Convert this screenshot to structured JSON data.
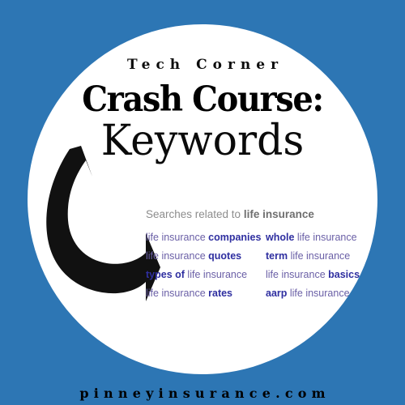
{
  "colors": {
    "background_blue": "#2d76b4",
    "circle_white": "#ffffff",
    "title_black": "#000000",
    "heading_gray": "#8d8d8d",
    "keyword_purple": "#6a5fa6",
    "keyword_bold_blue": "#2f2fa0",
    "arrow_black": "#111111"
  },
  "header": {
    "kicker": "Tech Corner",
    "title": "Crash Course:",
    "subtitle": "Keywords"
  },
  "arrow": {
    "icon": "curved-arrow-icon",
    "direction": "down-right"
  },
  "search": {
    "heading_prefix": "Searches related to ",
    "heading_term": "life insurance",
    "columns": 2,
    "items": [
      {
        "prefix": "life insurance ",
        "bold": "companies",
        "suffix": ""
      },
      {
        "prefix": "",
        "bold": "whole",
        "suffix": " life insurance"
      },
      {
        "prefix": "life insurance ",
        "bold": "quotes",
        "suffix": ""
      },
      {
        "prefix": "",
        "bold": "term",
        "suffix": " life insurance"
      },
      {
        "prefix": "",
        "bold": "types of",
        "suffix": " life insurance"
      },
      {
        "prefix": "life insurance ",
        "bold": "basics",
        "suffix": ""
      },
      {
        "prefix": "life insurance ",
        "bold": "rates",
        "suffix": ""
      },
      {
        "prefix": "",
        "bold": "aarp",
        "suffix": " life insurance"
      }
    ]
  },
  "footer": {
    "url": "pinneyinsurance.com"
  }
}
